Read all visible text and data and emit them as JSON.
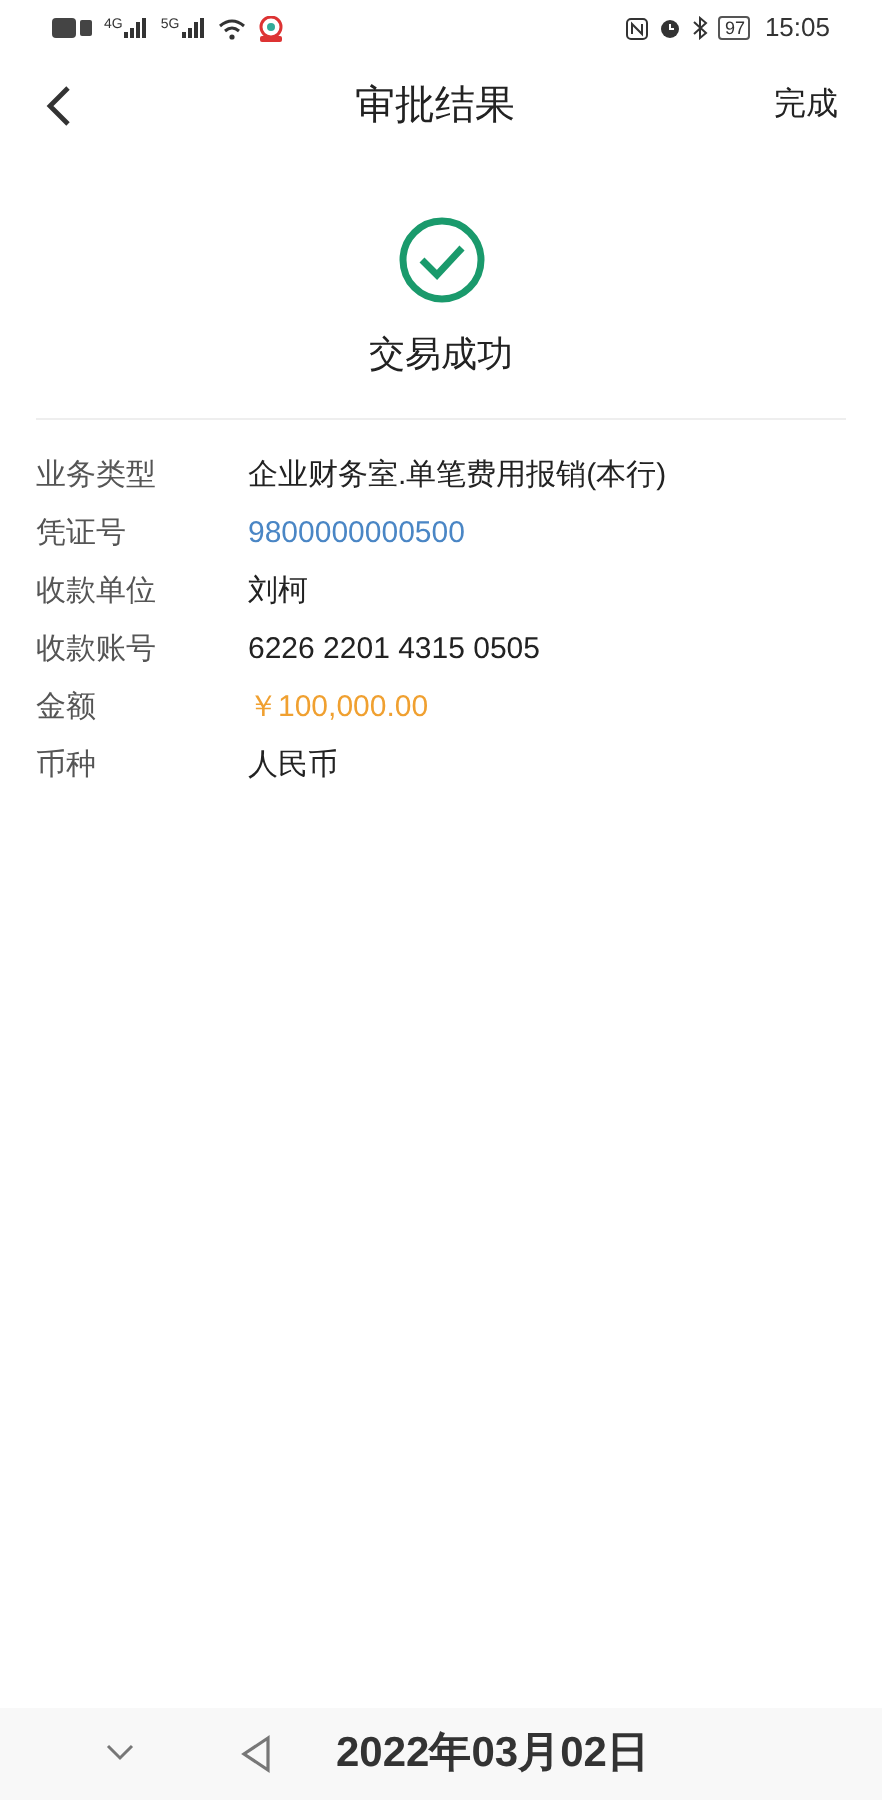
{
  "status_bar": {
    "network_labels": [
      "4G",
      "5G"
    ],
    "battery": "97",
    "time": "15:05"
  },
  "header": {
    "title": "审批结果",
    "action": "完成"
  },
  "result": {
    "status": "交易成功"
  },
  "details": [
    {
      "label": "业务类型",
      "value": "企业财务室.单笔费用报销(本行)",
      "kind": "plain"
    },
    {
      "label": "凭证号",
      "value": "9800000000500",
      "kind": "link"
    },
    {
      "label": "收款单位",
      "value": "刘柯",
      "kind": "plain"
    },
    {
      "label": "收款账号",
      "value": "6226 2201 4315 0505",
      "kind": "plain"
    },
    {
      "label": "金额",
      "value": "￥100,000.00",
      "kind": "amount"
    },
    {
      "label": "币种",
      "value": "人民币",
      "kind": "plain"
    }
  ],
  "date_stamp": "2022年03月02日"
}
